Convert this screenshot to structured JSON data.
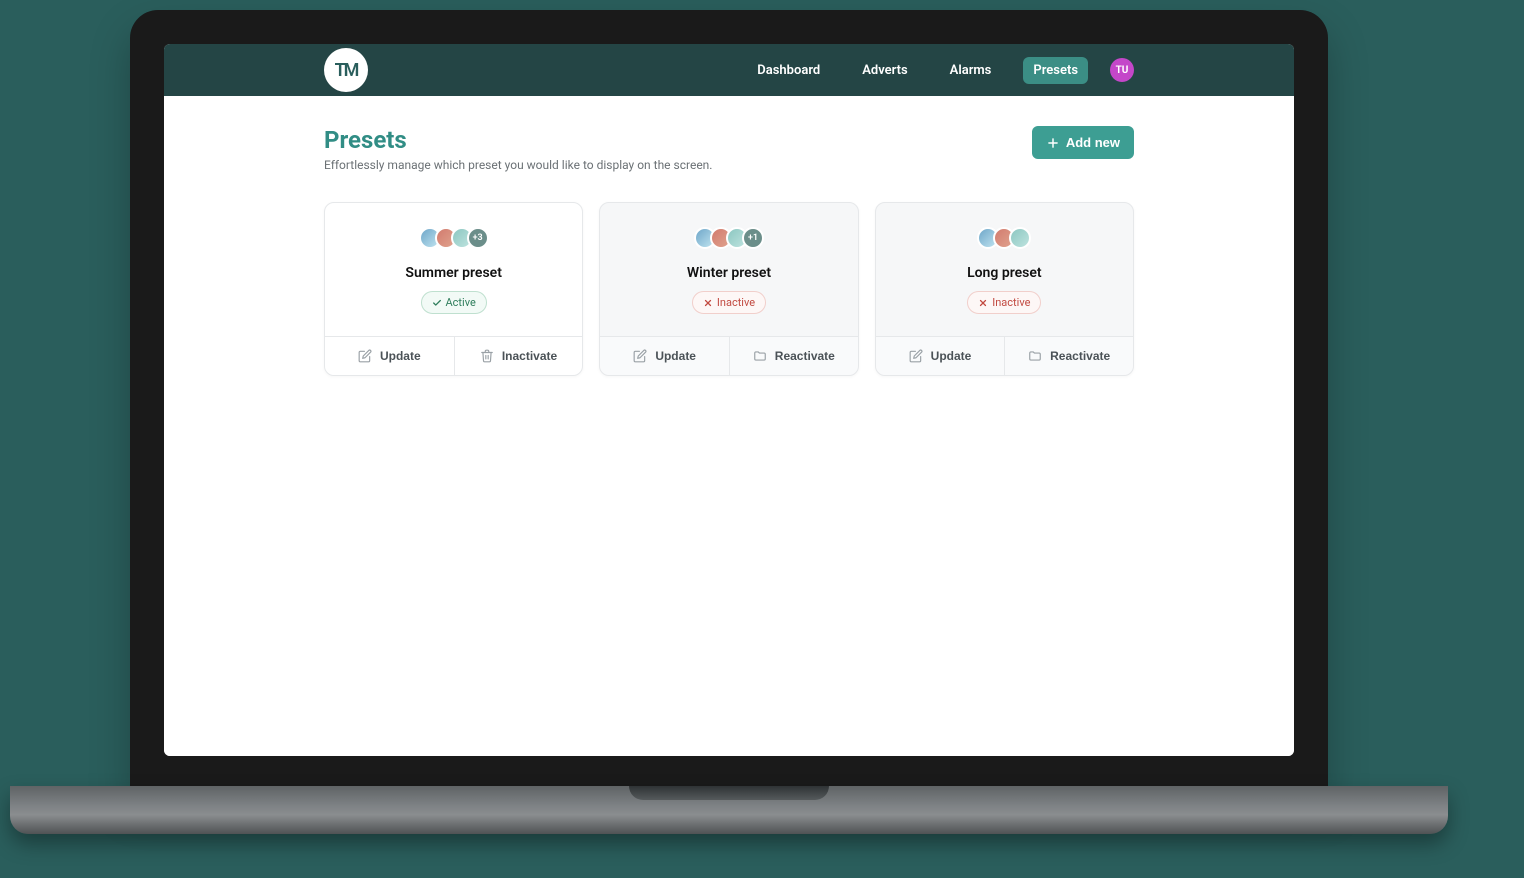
{
  "brand": {
    "logo_text": "TM"
  },
  "nav": {
    "items": [
      {
        "label": "Dashboard",
        "active": false
      },
      {
        "label": "Adverts",
        "active": false
      },
      {
        "label": "Alarms",
        "active": false
      },
      {
        "label": "Presets",
        "active": true
      }
    ],
    "avatar_initials": "TU"
  },
  "page": {
    "title": "Presets",
    "subtitle": "Effortlessly manage which preset you would like to display on the screen.",
    "add_button": "Add new"
  },
  "status_labels": {
    "active": "Active",
    "inactive": "Inactive"
  },
  "action_labels": {
    "update": "Update",
    "inactivate": "Inactivate",
    "reactivate": "Reactivate"
  },
  "presets": [
    {
      "name": "Summer preset",
      "status": "active",
      "extra_count": "+3",
      "thumbs": 3,
      "secondary_action": "inactivate"
    },
    {
      "name": "Winter preset",
      "status": "inactive",
      "extra_count": "+1",
      "thumbs": 3,
      "secondary_action": "reactivate"
    },
    {
      "name": "Long preset",
      "status": "inactive",
      "extra_count": "",
      "thumbs": 3,
      "secondary_action": "reactivate"
    }
  ]
}
